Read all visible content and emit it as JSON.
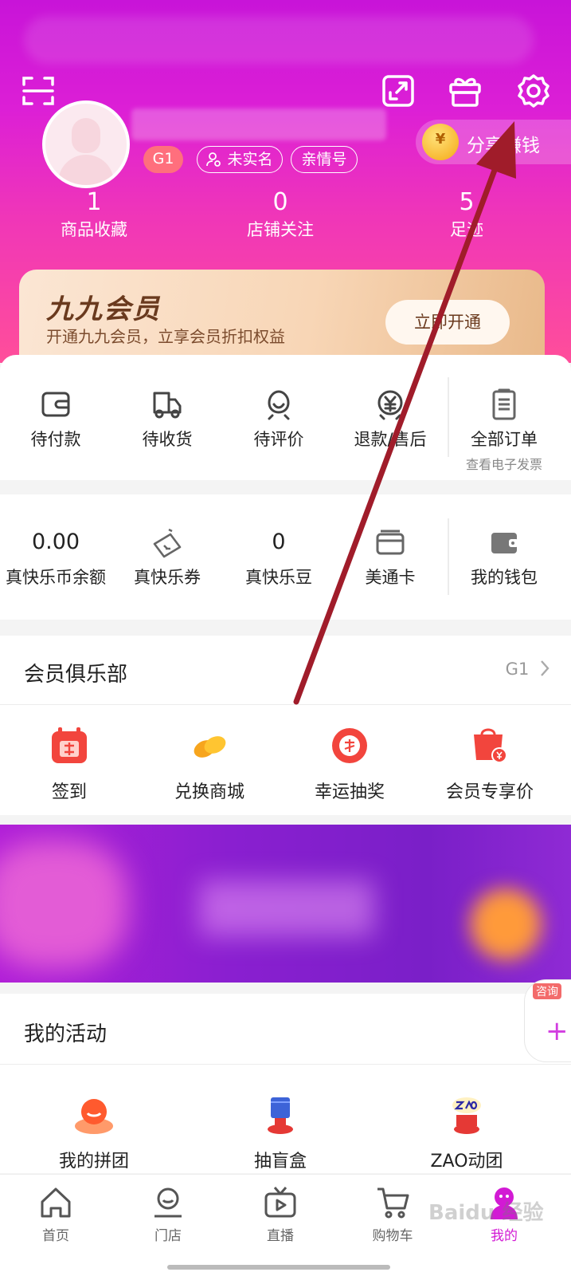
{
  "header": {
    "level_tag": "G1",
    "realname_tag": "未实名",
    "family_tag": "亲情号",
    "share_label": "分享赚钱",
    "coin_glyph": "¥",
    "stats": [
      {
        "value": "1",
        "label": "商品收藏"
      },
      {
        "value": "0",
        "label": "店铺关注"
      },
      {
        "value": "5",
        "label": "足迹"
      }
    ]
  },
  "vip": {
    "title": "九九会员",
    "subtitle": "开通九九会员，立享会员折扣权益",
    "button": "立即开通"
  },
  "orders": {
    "items": [
      {
        "label": "待付款",
        "icon": "wallet-pay-icon"
      },
      {
        "label": "待收货",
        "icon": "truck-icon"
      },
      {
        "label": "待评价",
        "icon": "smile-icon"
      },
      {
        "label": "退款/售后",
        "icon": "yen-refund-icon"
      },
      {
        "label": "全部订单",
        "sub": "查看电子发票",
        "icon": "clipboard-icon"
      }
    ]
  },
  "wallet": {
    "items": [
      {
        "value": "0.00",
        "label": "真快乐币余额"
      },
      {
        "label": "真快乐券"
      },
      {
        "value": "0",
        "label": "真快乐豆"
      },
      {
        "label": "美通卡"
      },
      {
        "label": "我的钱包"
      }
    ]
  },
  "club": {
    "title": "会员俱乐部",
    "level": "G1",
    "items": [
      {
        "label": "签到"
      },
      {
        "label": "兑换商城"
      },
      {
        "label": "幸运抽奖"
      },
      {
        "label": "会员专享价"
      }
    ]
  },
  "consult": {
    "tip": "咨询",
    "plus": "+"
  },
  "activity": {
    "title": "我的活动",
    "items": [
      {
        "label": "我的拼团"
      },
      {
        "label": "抽盲盒"
      },
      {
        "label": "ZAO动团"
      }
    ]
  },
  "nav": {
    "items": [
      {
        "label": "首页"
      },
      {
        "label": "门店"
      },
      {
        "label": "直播"
      },
      {
        "label": "购物车"
      },
      {
        "label": "我的"
      }
    ],
    "active_index": 4
  },
  "watermark": "Baidu 经验",
  "colors": {
    "brand": "#d21ad4",
    "annotation_arrow": "#a01c2a"
  }
}
